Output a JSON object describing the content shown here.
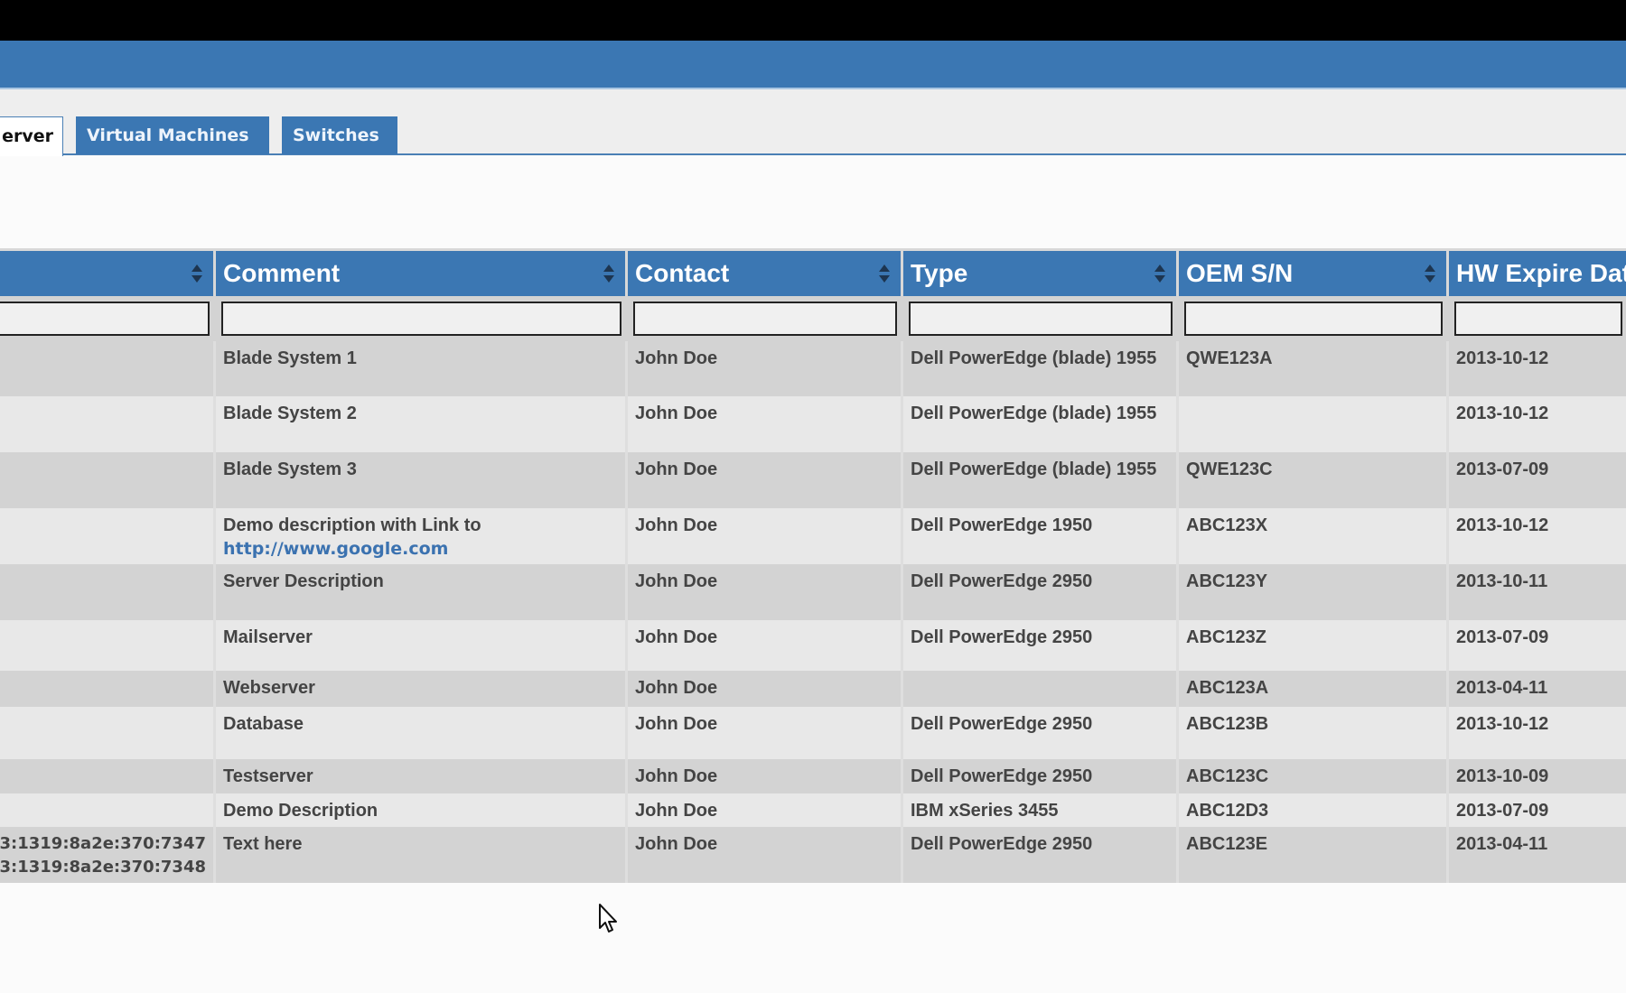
{
  "tabs": [
    {
      "label": "erver",
      "active": true
    },
    {
      "label": "Virtual Machines",
      "active": false
    },
    {
      "label": "Switches",
      "active": false
    }
  ],
  "table": {
    "columns": [
      "",
      "Comment",
      "Contact",
      "Type",
      "OEM S/N",
      "HW Expire Dat"
    ],
    "rows": [
      {
        "ip": "",
        "comment": "Blade System 1",
        "contact": "John Doe",
        "type": "Dell PowerEdge (blade) 1955",
        "oem_sn": "QWE123A",
        "hw_expire": "2013-10-12"
      },
      {
        "ip": "",
        "comment": "Blade System 2",
        "contact": "John Doe",
        "type": "Dell PowerEdge (blade) 1955",
        "oem_sn": "",
        "hw_expire": "2013-10-12"
      },
      {
        "ip": "",
        "comment": "Blade System 3",
        "contact": "John Doe",
        "type": "Dell PowerEdge (blade) 1955",
        "oem_sn": "QWE123C",
        "hw_expire": "2013-07-09"
      },
      {
        "ip": "",
        "comment": "Demo description with Link to",
        "comment_link": "http://www.google.com",
        "contact": "John Doe",
        "type": "Dell PowerEdge 1950",
        "oem_sn": "ABC123X",
        "hw_expire": "2013-10-12"
      },
      {
        "ip": "",
        "comment": "Server Description",
        "contact": "John Doe",
        "type": "Dell PowerEdge 2950",
        "oem_sn": "ABC123Y",
        "hw_expire": "2013-10-11"
      },
      {
        "ip": "",
        "comment": "Mailserver",
        "contact": "John Doe",
        "type": "Dell PowerEdge 2950",
        "oem_sn": "ABC123Z",
        "hw_expire": "2013-07-09"
      },
      {
        "ip": "",
        "comment": "Webserver",
        "contact": "John Doe",
        "type": "",
        "oem_sn": "ABC123A",
        "hw_expire": "2013-04-11"
      },
      {
        "ip": "",
        "comment": "Database",
        "contact": "John Doe",
        "type": "Dell PowerEdge 2950",
        "oem_sn": "ABC123B",
        "hw_expire": "2013-10-12"
      },
      {
        "ip": "",
        "comment": "Testserver",
        "contact": "John Doe",
        "type": "Dell PowerEdge 2950",
        "oem_sn": "ABC123C",
        "hw_expire": "2013-10-09"
      },
      {
        "ip": "",
        "comment": "Demo Description",
        "contact": "John Doe",
        "type": "IBM xSeries 3455",
        "oem_sn": "ABC12D3",
        "hw_expire": "2013-07-09"
      },
      {
        "ip": "3:1319:8a2e:370:7347",
        "ip2": "3:1319:8a2e:370:7348",
        "comment": "Text here",
        "contact": "John Doe",
        "type": "Dell PowerEdge 2950",
        "oem_sn": "ABC123E",
        "hw_expire": "2013-04-11"
      }
    ]
  },
  "colors": {
    "accent": "#3b77b3",
    "row_odd": "#d3d3d3",
    "row_even": "#e8e8e8",
    "link": "#3b72b0"
  }
}
